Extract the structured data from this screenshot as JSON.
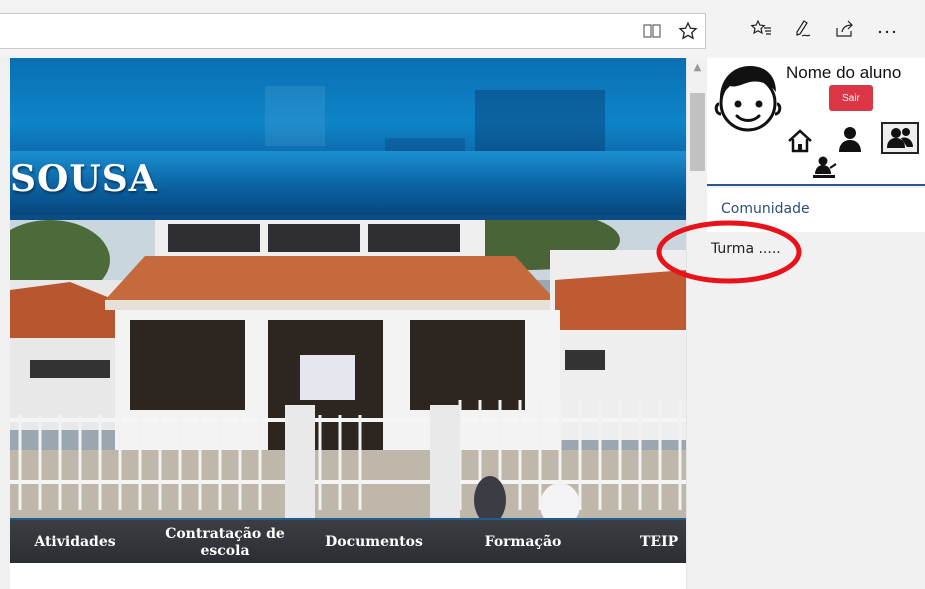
{
  "site": {
    "banner_title": "SOUSA",
    "nav": [
      "Atividades",
      "Contratação de escola",
      "Documentos",
      "Formação",
      "TEIP"
    ]
  },
  "panel": {
    "student_name": "Nome do aluno",
    "logout_label": "Sair",
    "community_link": "Comunidade",
    "class_item": "Turma ....."
  },
  "colors": {
    "logout_button": "#dc3545",
    "banner_blue": "#0a6fb3",
    "annotation_red": "#e8121a",
    "nav_bar": "#2f3337"
  },
  "icons": {
    "reading_view": "book-icon",
    "favorite": "star-icon",
    "favorites_hub": "favorites-list-icon",
    "web_note": "pen-icon",
    "share": "share-icon",
    "more": "more-icon",
    "home": "home-icon",
    "profile": "user-icon",
    "group": "group-icon",
    "teacher": "teacher-icon"
  }
}
